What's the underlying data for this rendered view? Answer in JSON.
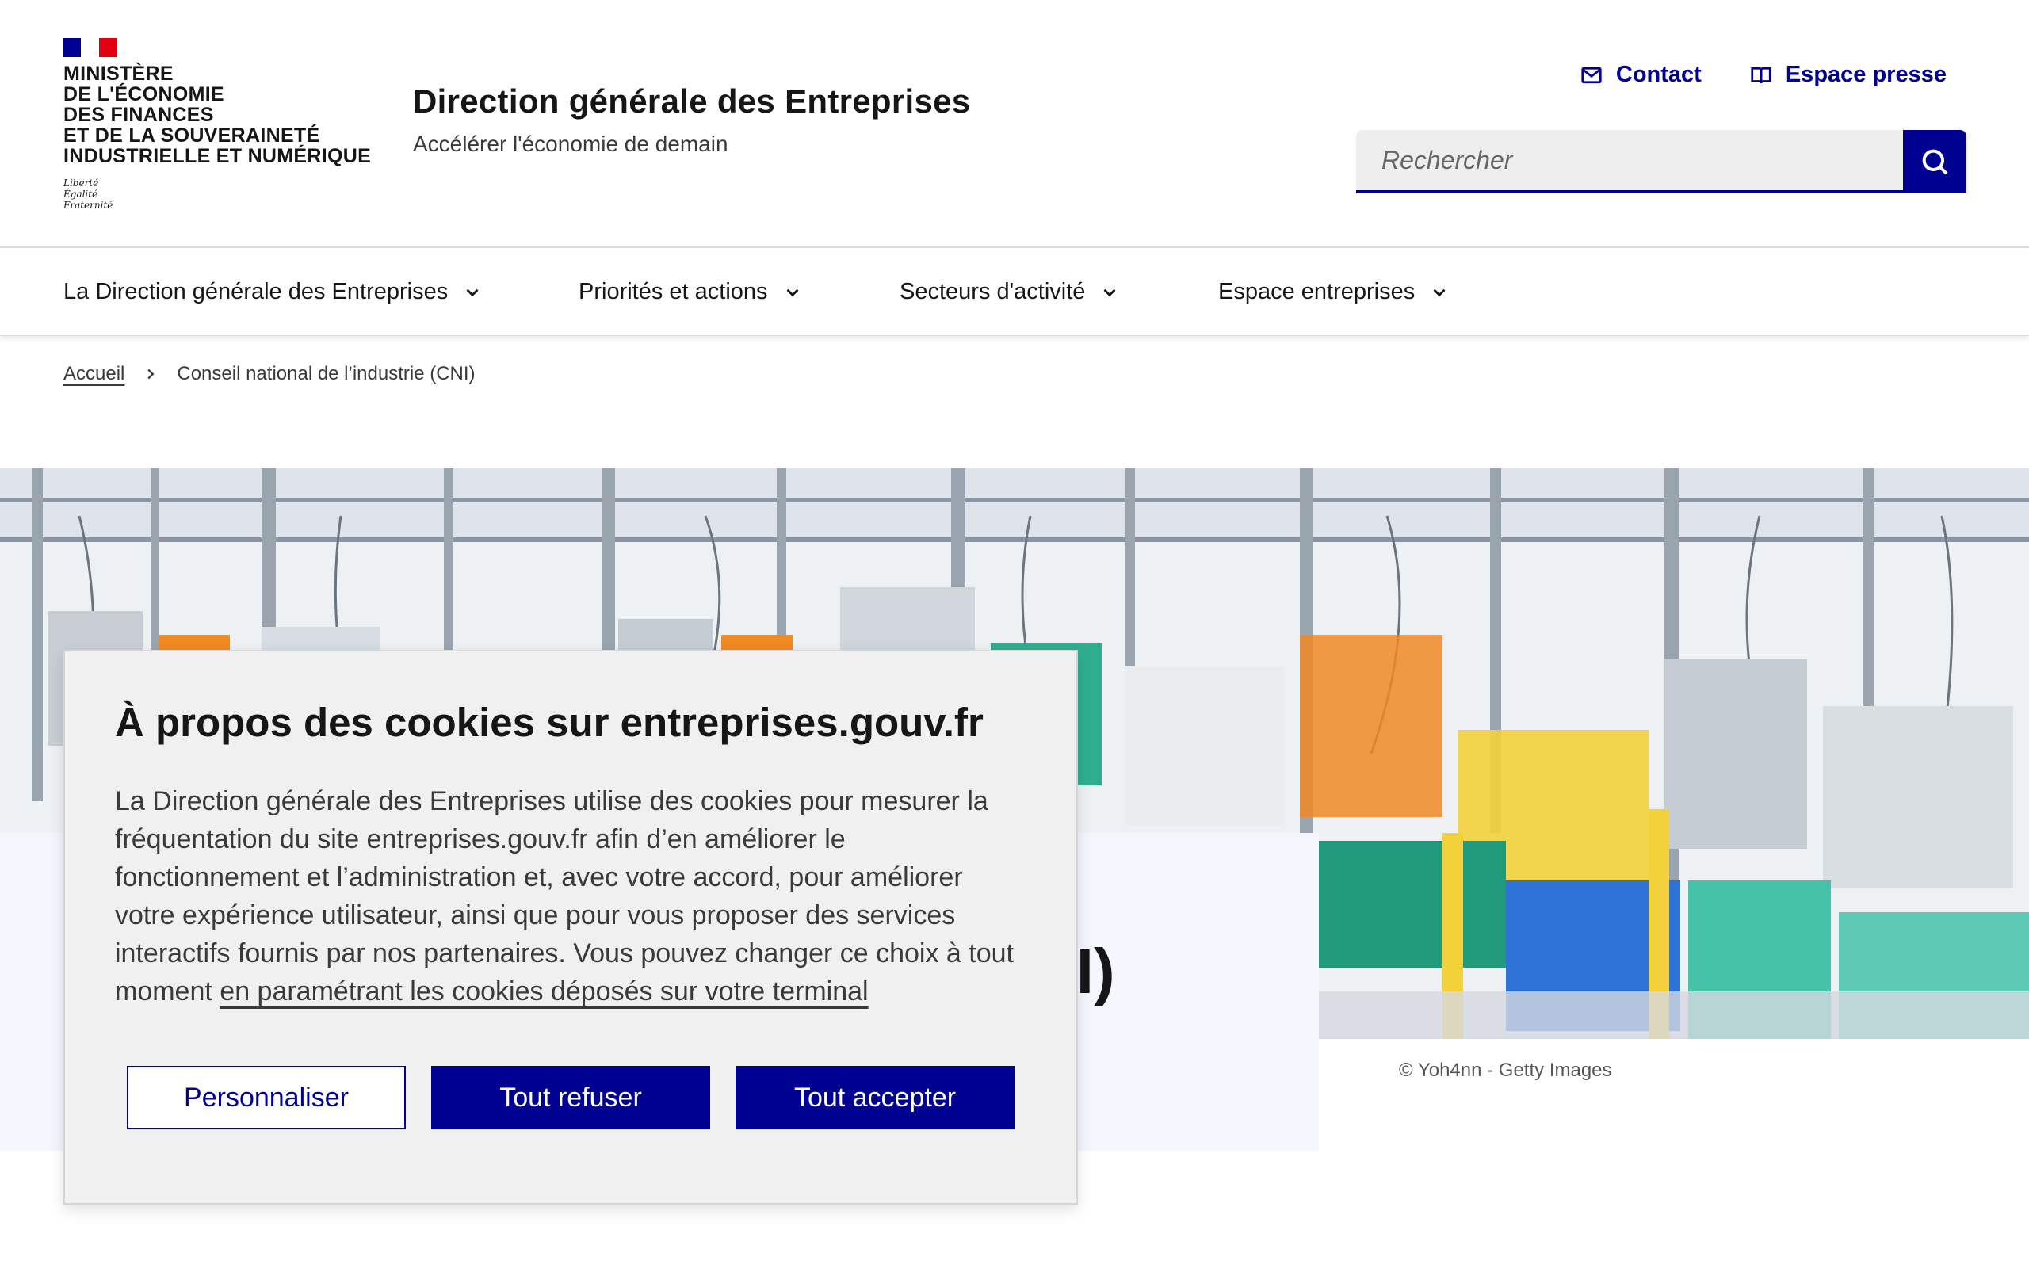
{
  "colors": {
    "brand_blue": "#000091",
    "marianne_blue": "#000091",
    "marianne_red": "#e1000f",
    "panel_bg": "#f5f5fe",
    "modal_bg": "#f0f0f0"
  },
  "header": {
    "logo": {
      "lines": [
        "Ministère",
        "de l'économie",
        "des finances",
        "et de la souveraineté",
        "industrielle et numérique"
      ],
      "motto": [
        "Liberté",
        "Égalité",
        "Fraternité"
      ]
    },
    "service_title": "Direction générale des Entreprises",
    "service_tagline": "Accélérer l'économie de demain",
    "tools": [
      {
        "label": "Contact",
        "icon": "mail-icon"
      },
      {
        "label": "Espace presse",
        "icon": "book-icon"
      }
    ],
    "search": {
      "placeholder": "Rechercher",
      "value": "",
      "icon": "search-icon"
    }
  },
  "nav": {
    "items": [
      {
        "label": "La Direction générale des Entreprises"
      },
      {
        "label": "Priorités et actions"
      },
      {
        "label": "Secteurs d'activité"
      },
      {
        "label": "Espace entreprises"
      }
    ]
  },
  "breadcrumb": {
    "home": "Accueil",
    "current": "Conseil national de l’industrie (CNI)"
  },
  "hero": {
    "title_visible": "NI)",
    "photo_credit": "© Yoh4nn - Getty Images"
  },
  "cookie_banner": {
    "title": "À propos des cookies sur entreprises.gouv.fr",
    "body": "La Direction générale des Entreprises utilise des cookies pour mesurer la fréquentation du site entreprises.gouv.fr afin d’en améliorer le fonctionnement et l’administration et, avec votre accord, pour améliorer votre expérience utilisateur, ainsi que pour vous proposer des services interactifs fournis par nos partenaires. Vous pouvez changer ce choix à tout moment",
    "link": "en paramétrant les cookies déposés sur votre terminal",
    "buttons": {
      "customize": "Personnaliser",
      "refuse_all": "Tout refuser",
      "accept_all": "Tout accepter"
    }
  }
}
